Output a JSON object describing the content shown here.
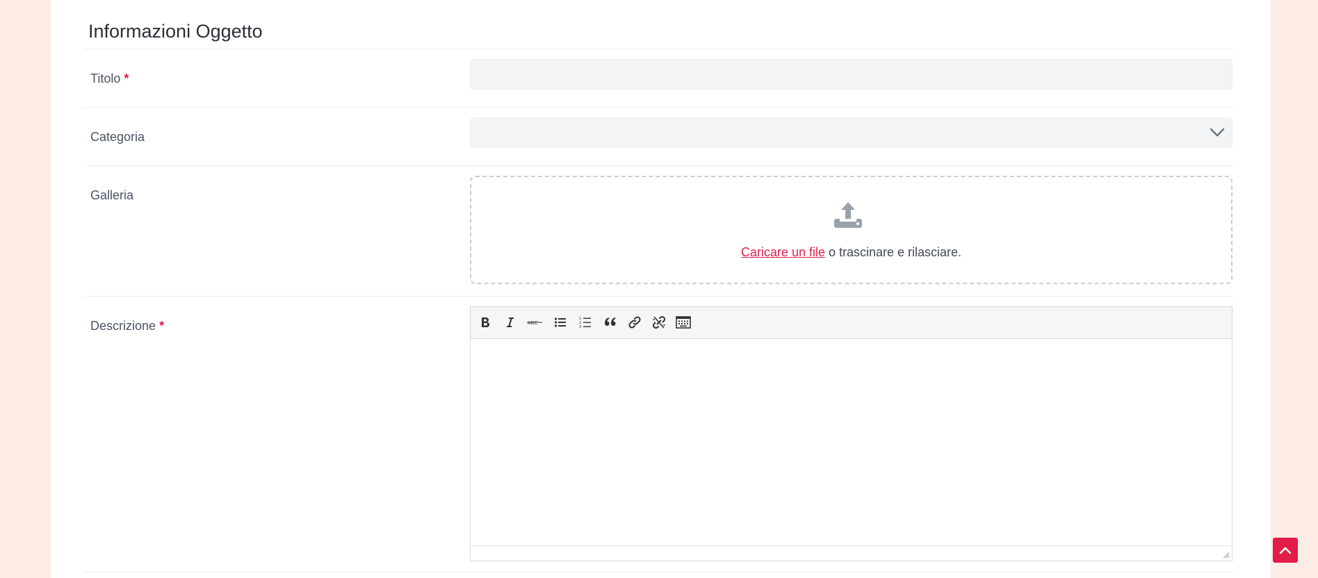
{
  "section": {
    "title": "Informazioni Oggetto"
  },
  "fields": {
    "titolo": {
      "label": "Titolo",
      "required_mark": "*",
      "value": ""
    },
    "categoria": {
      "label": "Categoria",
      "value": ""
    },
    "galleria": {
      "label": "Galleria",
      "upload_link": "Caricare un file",
      "upload_hint": " o trascinare e rilasciare."
    },
    "descrizione": {
      "label": "Descrizione",
      "required_mark": "*",
      "value": ""
    }
  },
  "toolbar": {
    "buttons": [
      "bold",
      "italic",
      "strikethrough",
      "bullet-list",
      "numbered-list",
      "blockquote",
      "link",
      "unlink",
      "keyboard"
    ]
  },
  "colors": {
    "accent": "#e11d48",
    "page_bg": "#fdebe5",
    "input_bg": "#f3f4f6"
  }
}
